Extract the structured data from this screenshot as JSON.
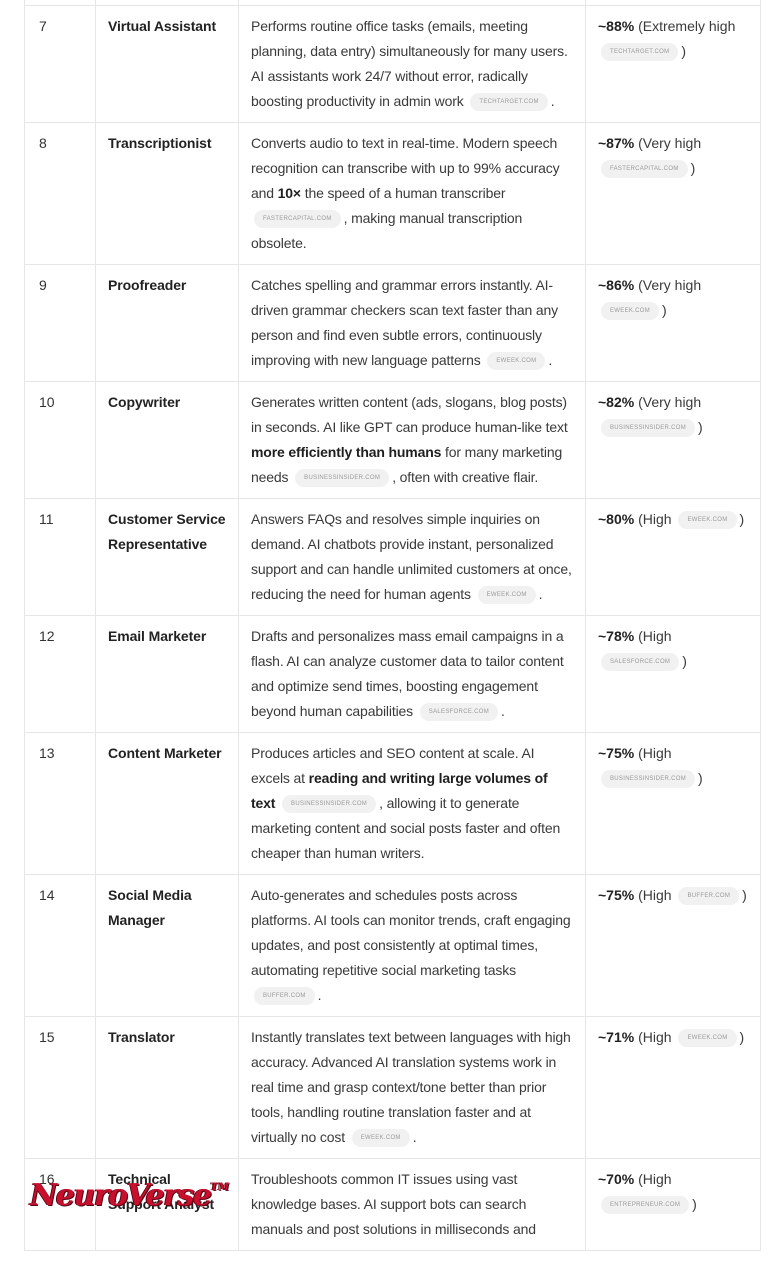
{
  "table": {
    "rows": [
      {
        "num": "7",
        "role": "Virtual Assistant",
        "desc": [
          {
            "t": "Performs routine office tasks (emails, meeting planning, data entry) simultaneously for many users. AI assistants work 24/7 without error, radically boosting productivity in admin work "
          },
          {
            "chip": "techtarget.com"
          },
          {
            "t": "."
          }
        ],
        "risk_pct": "~88%",
        "risk_label": "(Extremely high",
        "risk_source": "techtarget.com",
        "risk_close": ")"
      },
      {
        "num": "8",
        "role": "Transcriptionist",
        "desc": [
          {
            "t": "Converts audio to text in real-time. Modern speech recognition can transcribe with up to 99% accuracy and "
          },
          {
            "b": "10×"
          },
          {
            "t": " the speed of a human transcriber "
          },
          {
            "chip": "fastercapital.com"
          },
          {
            "t": ", making manual transcription obsolete."
          }
        ],
        "risk_pct": "~87%",
        "risk_label": "(Very high",
        "risk_source": "fastercapital.com",
        "risk_close": ")"
      },
      {
        "num": "9",
        "role": "Proofreader",
        "desc": [
          {
            "t": "Catches spelling and grammar errors instantly. AI-driven grammar checkers scan text faster than any person and find even subtle errors, continuously improving with new language patterns "
          },
          {
            "chip": "eweek.com"
          },
          {
            "t": "."
          }
        ],
        "risk_pct": "~86%",
        "risk_label": "(Very high",
        "risk_source": "eweek.com",
        "risk_close": ")"
      },
      {
        "num": "10",
        "role": "Copywriter",
        "desc": [
          {
            "t": "Generates written content (ads, slogans, blog posts) in seconds. AI like GPT can produce human-like text "
          },
          {
            "b": "more efficiently than humans"
          },
          {
            "t": " for many marketing needs "
          },
          {
            "chip": "businessinsider.com"
          },
          {
            "t": ", often with creative flair."
          }
        ],
        "risk_pct": "~82%",
        "risk_label": "(Very high",
        "risk_source": "businessinsider.com",
        "risk_close": ")"
      },
      {
        "num": "11",
        "role": "Customer Service Representative",
        "desc": [
          {
            "t": "Answers FAQs and resolves simple inquiries on demand. AI chatbots provide instant, personalized support and can handle unlimited customers at once, reducing the need for human agents "
          },
          {
            "chip": "eweek.com"
          },
          {
            "t": "."
          }
        ],
        "risk_pct": "~80%",
        "risk_label": "(High",
        "risk_source": "eweek.com",
        "risk_close": ")"
      },
      {
        "num": "12",
        "role": "Email Marketer",
        "desc": [
          {
            "t": "Drafts and personalizes mass email campaigns in a flash. AI can analyze customer data to tailor content and optimize send times, boosting engagement beyond human capabilities "
          },
          {
            "chip": "salesforce.com"
          },
          {
            "t": "."
          }
        ],
        "risk_pct": "~78%",
        "risk_label": "(High",
        "risk_source": "salesforce.com",
        "risk_close": ")"
      },
      {
        "num": "13",
        "role": "Content Marketer",
        "desc": [
          {
            "t": "Produces articles and SEO content at scale. AI excels at "
          },
          {
            "b": "reading and writing large volumes of text"
          },
          {
            "t": " "
          },
          {
            "chip": "businessinsider.com"
          },
          {
            "t": ", allowing it to generate marketing content and social posts faster and often cheaper than human writers."
          }
        ],
        "risk_pct": "~75%",
        "risk_label": "(High",
        "risk_source": "businessinsider.com",
        "risk_close": ")"
      },
      {
        "num": "14",
        "role": "Social Media Manager",
        "desc": [
          {
            "t": "Auto-generates and schedules posts across platforms. AI tools can monitor trends, craft engaging updates, and post consistently at optimal times, automating repetitive social marketing tasks "
          },
          {
            "chip": "buffer.com"
          },
          {
            "t": "."
          }
        ],
        "risk_pct": "~75%",
        "risk_label": "(High",
        "risk_source": "buffer.com",
        "risk_close": ")"
      },
      {
        "num": "15",
        "role": "Translator",
        "desc": [
          {
            "t": "Instantly translates text between languages with high accuracy. Advanced AI translation systems work in real time and grasp context/tone better than prior tools, handling routine translation faster and at virtually no cost "
          },
          {
            "chip": "eweek.com"
          },
          {
            "t": "."
          }
        ],
        "risk_pct": "~71%",
        "risk_label": "(High",
        "risk_source": "eweek.com",
        "risk_close": ")"
      },
      {
        "num": "16",
        "role": "Technical Support Analyst",
        "desc": [
          {
            "t": "Troubleshoots common IT issues using vast knowledge bases. AI support bots can search manuals and post solutions in milliseconds and"
          }
        ],
        "risk_pct": "~70%",
        "risk_label": "(High",
        "risk_source": "entrepreneur.com",
        "risk_close": ")"
      }
    ]
  },
  "watermark": {
    "brand": "NeuroVerse",
    "trademark": "TM",
    "color": "#c8102e"
  }
}
